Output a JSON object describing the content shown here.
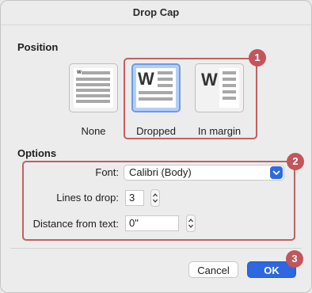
{
  "dialog": {
    "title": "Drop Cap"
  },
  "position": {
    "section_label": "Position",
    "options": [
      {
        "label": "None",
        "glyph": "W",
        "selected": false
      },
      {
        "label": "Dropped",
        "glyph": "W",
        "selected": true
      },
      {
        "label": "In margin",
        "glyph": "W",
        "selected": false
      }
    ]
  },
  "options": {
    "section_label": "Options",
    "font": {
      "label": "Font:",
      "value": "Calibri (Body)"
    },
    "lines_to_drop": {
      "label": "Lines to drop:",
      "value": "3"
    },
    "distance": {
      "label": "Distance from text:",
      "value": "0\""
    }
  },
  "buttons": {
    "cancel": "Cancel",
    "ok": "OK"
  },
  "callouts": [
    "1",
    "2",
    "3"
  ],
  "colors": {
    "accent": "#2e67df",
    "callout": "#c2565a",
    "selected_tile": "#b3cff6"
  }
}
